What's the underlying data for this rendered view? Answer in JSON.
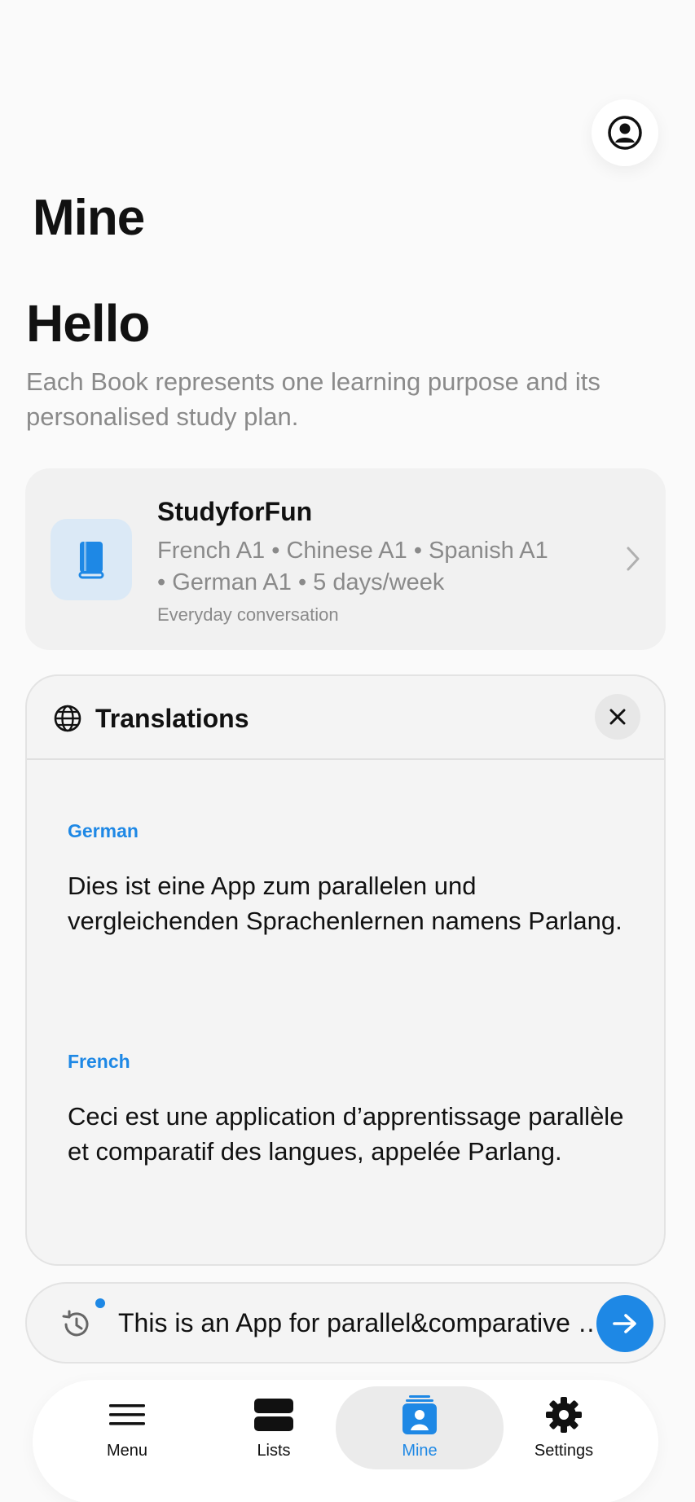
{
  "header": {
    "page_title": "Mine",
    "profile_icon": "user-circle-icon"
  },
  "intro": {
    "greeting": "Hello",
    "description": "Each Book represents one learning purpose and its personalised study plan."
  },
  "book": {
    "name": "StudyforFun",
    "languages_line1": "French A1 • Chinese A1 • Spanish A1",
    "languages_line2": "• German A1 • 5 days/week",
    "purpose": "Everyday conversation",
    "icon": "book-icon"
  },
  "translations": {
    "title": "Translations",
    "items": [
      {
        "language": "German",
        "text": "Dies ist eine App zum parallelen und vergleichenden Sprachenlernen namens Parlang."
      },
      {
        "language": "French",
        "text": "Ceci est une application d’apprentissage parallèle et comparatif des langues, appelée Parlang."
      }
    ]
  },
  "input": {
    "value": "This is an App for parallel&comparative language learning called Parlang."
  },
  "tabs": [
    {
      "label": "Menu",
      "icon": "menu-icon",
      "active": false
    },
    {
      "label": "Lists",
      "icon": "lists-icon",
      "active": false
    },
    {
      "label": "Mine",
      "icon": "mine-icon",
      "active": true
    },
    {
      "label": "Settings",
      "icon": "gear-icon",
      "active": false
    }
  ],
  "colors": {
    "accent": "#1e88e5",
    "secondary_text": "#8a8a8a",
    "card_background": "#f1f1f1"
  }
}
